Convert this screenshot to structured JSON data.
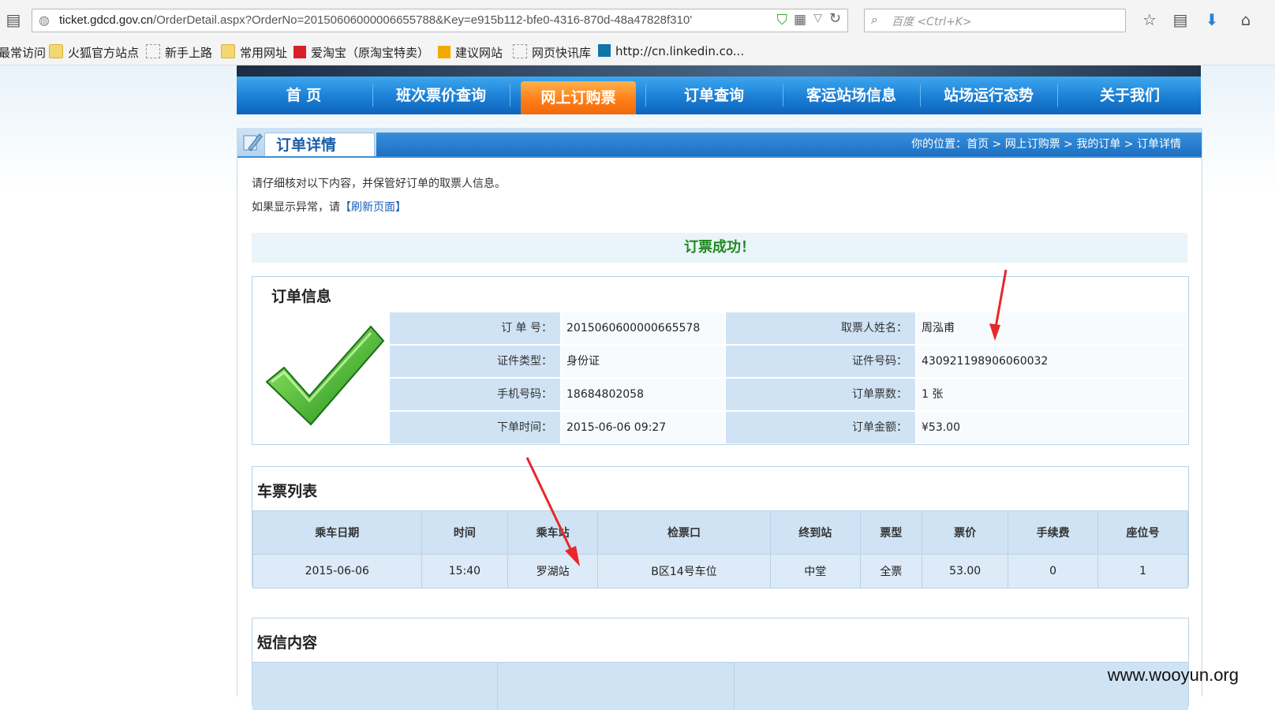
{
  "browser": {
    "url_host": "ticket.gdcd.gov.cn",
    "url_path": "/OrderDetail.aspx?OrderNo=20150606000006655788&Key=e915b112-bfe0-4316-870d-48a47828f310'",
    "search_placeholder": "百度 <Ctrl+K>",
    "bookmarks": [
      "最常访问",
      "火狐官方站点",
      "新手上路",
      "常用网址",
      "爱淘宝（原淘宝特卖）",
      "建议网站",
      "网页快讯库",
      "http://cn.linkedin.co..."
    ]
  },
  "nav": {
    "items": [
      "首 页",
      "班次票价查询",
      "网上订购票",
      "订单查询",
      "客运站场信息",
      "站场运行态势",
      "关于我们"
    ],
    "active_index": 2
  },
  "page": {
    "title": "订单详情",
    "breadcrumb": "你的位置：首页 > 网上订购票 > 我的订单 > 订单详情",
    "notice_line1": "请仔细核对以下内容，并保管好订单的取票人信息。",
    "notice_line2_prefix": "如果显示异常，请",
    "refresh_link": "【刷新页面】",
    "success_text": "订票成功！"
  },
  "order_info": {
    "title": "订单信息",
    "order_no_label": "订 单 号：",
    "order_no": "2015060600000665578",
    "picker_label": "取票人姓名：",
    "picker": "周泓甫",
    "id_type_label": "证件类型：",
    "id_type": "身份证",
    "id_no_label": "证件号码：",
    "id_no": "430921198906060032",
    "phone_label": "手机号码：",
    "phone": "18684802058",
    "count_label": "订单票数：",
    "count": "1 张",
    "time_label": "下单时间：",
    "time": "2015-06-06 09:27",
    "amount_label": "订单金额：",
    "amount": "¥53.00"
  },
  "tickets": {
    "title": "车票列表",
    "headers": [
      "乘车日期",
      "时间",
      "乘车站",
      "检票口",
      "终到站",
      "票型",
      "票价",
      "手续费",
      "座位号"
    ],
    "row": [
      "2015-06-06",
      "15:40",
      "罗湖站",
      "B区14号车位",
      "中堂",
      "全票",
      "53.00",
      "0",
      "1"
    ]
  },
  "sms": {
    "title": "短信内容"
  },
  "watermark": "www.wooyun.org",
  "colors": {
    "nav_blue": "#1b7fd4",
    "active_orange": "#ff7a14",
    "success_green": "#1f8a1f",
    "arrow_red": "#e8262b"
  }
}
